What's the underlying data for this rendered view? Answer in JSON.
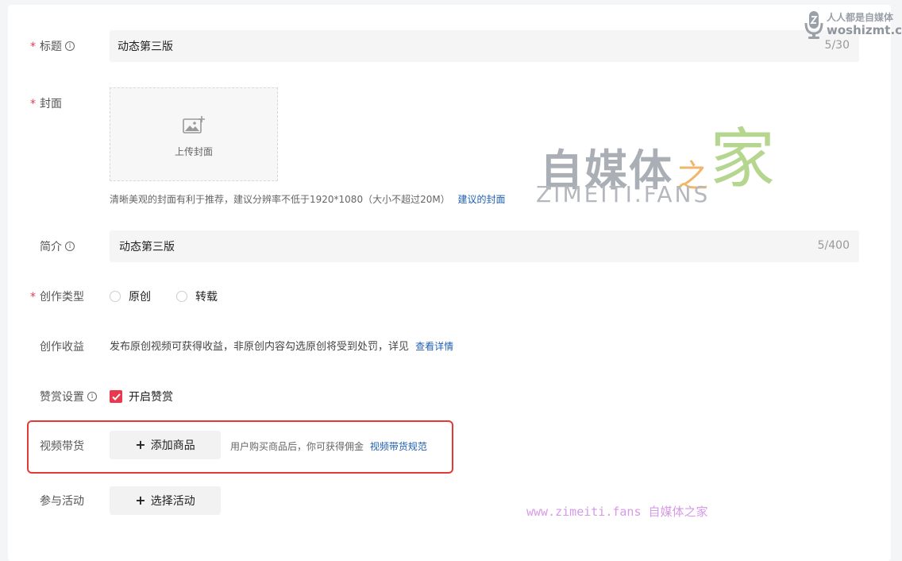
{
  "form": {
    "title": {
      "label": "标题",
      "value": "动态第三版",
      "counter": "5/30"
    },
    "cover": {
      "label": "封面",
      "upload_label": "上传封面",
      "hint": "清晰美观的封面有利于推荐，建议分辨率不低于1920*1080（大小不超过20M）",
      "hint_link": "建议的封面"
    },
    "intro": {
      "label": "简介",
      "value": "动态第三版",
      "counter": "5/400"
    },
    "creation_type": {
      "label": "创作类型",
      "options": [
        "原创",
        "转载"
      ]
    },
    "creation_income": {
      "label": "创作收益",
      "text": "发布原创视频可获得收益，非原创内容勾选原创将受到处罚，详见",
      "link": "查看详情"
    },
    "reward": {
      "label": "赞赏设置",
      "checkbox_label": "开启赞赏",
      "checked": true
    },
    "video_goods": {
      "label": "视频带货",
      "button_label": "添加商品",
      "hint": "用户购买商品后，你可获得佣金",
      "hint_link": "视频带货规范"
    },
    "activity": {
      "label": "参与活动",
      "button_label": "选择活动"
    }
  },
  "watermarks": {
    "big_main": "自媒体",
    "big_zhi": "之",
    "big_jia": "家",
    "big_sub": "ZIMEITI.FANS",
    "corner_line1": "人人都是自媒体",
    "corner_line2": "woshizmt.cn",
    "url_line": "www.zimeiti.fans 自媒体之家"
  },
  "colors": {
    "accent": "#e8394f",
    "link": "#1f5fb0",
    "highlight": "#e53935"
  }
}
